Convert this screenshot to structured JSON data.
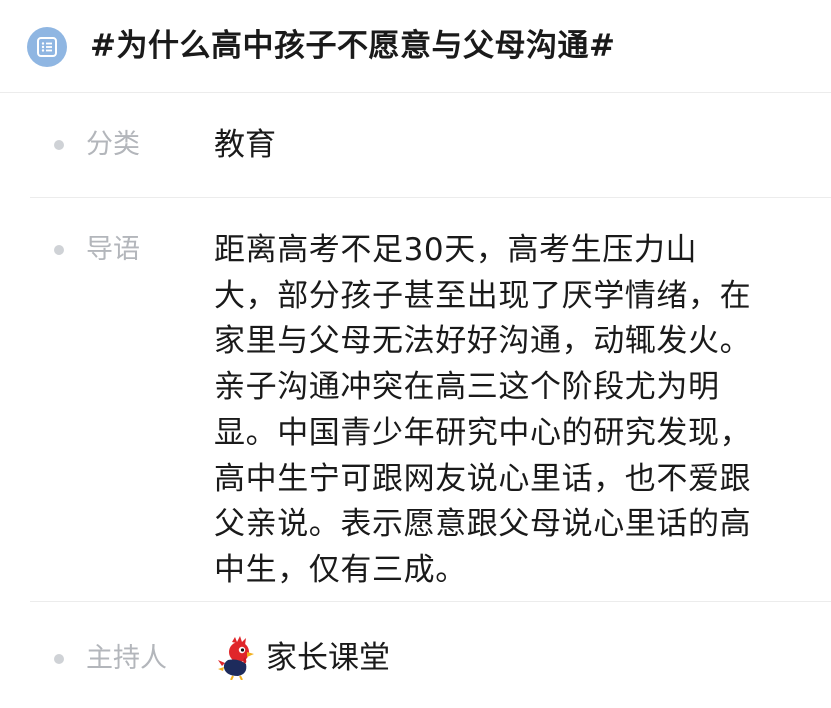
{
  "header": {
    "icon": "list-icon",
    "title": "#为什么高中孩子不愿意与父母沟通#"
  },
  "rows": {
    "category": {
      "label": "分类",
      "value": "教育"
    },
    "intro": {
      "label": "导语",
      "lines": [
        "距离高考不足30天，高考生压力山",
        "大，部分孩子甚至出现了厌学情绪，在",
        "家里与父母无法好好沟通，动辄发火。",
        "亲子沟通冲突在高三这个阶段尤为明",
        "显。中国青少年研究中心的研究发现，",
        "高中生宁可跟网友说心里话，也不爱跟",
        "父亲说。表示愿意跟父母说心里话的高",
        "中生，仅有三成。"
      ]
    },
    "host": {
      "label": "主持人",
      "value": "家长课堂",
      "avatar_icon": "rooster-avatar-icon"
    }
  },
  "colors": {
    "icon_bg": "#8fb6e2",
    "label": "#b3b6bb",
    "dot": "#cfd2d6",
    "divider": "#ececec",
    "text": "#1a1a1a"
  }
}
